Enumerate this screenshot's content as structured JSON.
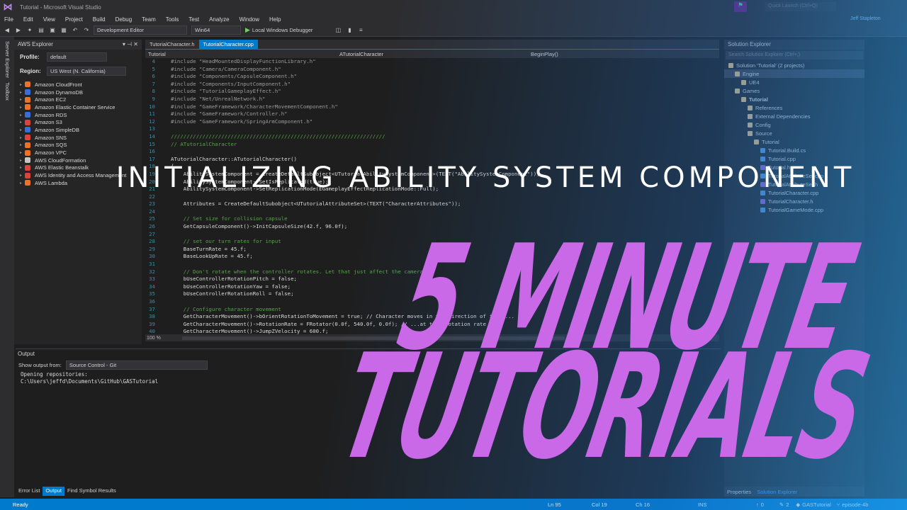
{
  "window": {
    "title": "Tutorial - Microsoft Visual Studio",
    "quick_launch": "Quick Launch (Ctrl+Q)",
    "user": "Jeff Stapleton"
  },
  "menu": [
    "File",
    "Edit",
    "View",
    "Project",
    "Build",
    "Debug",
    "Team",
    "Tools",
    "Test",
    "Analyze",
    "Window",
    "Help"
  ],
  "toolbar": {
    "configuration": "Development Editor",
    "platform": "Win64",
    "debugger": "Local Windows Debugger"
  },
  "side_tabs": [
    "Server Explorer",
    "Toolbox"
  ],
  "aws": {
    "title": "AWS Explorer",
    "profile_label": "Profile:",
    "profile_value": "default",
    "region_label": "Region:",
    "region_value": "US West (N. California)",
    "services": [
      {
        "name": "Amazon CloudFront",
        "color": "#e8732a"
      },
      {
        "name": "Amazon DynamoDB",
        "color": "#3b6fd8"
      },
      {
        "name": "Amazon EC2",
        "color": "#e8732a"
      },
      {
        "name": "Amazon Elastic Container Service",
        "color": "#e8732a"
      },
      {
        "name": "Amazon RDS",
        "color": "#3b6fd8"
      },
      {
        "name": "Amazon S3",
        "color": "#d9453d"
      },
      {
        "name": "Amazon SimpleDB",
        "color": "#3b6fd8"
      },
      {
        "name": "Amazon SNS",
        "color": "#d9453d"
      },
      {
        "name": "Amazon SQS",
        "color": "#e8732a"
      },
      {
        "name": "Amazon VPC",
        "color": "#e8732a"
      },
      {
        "name": "AWS CloudFormation",
        "color": "#c5c5c5"
      },
      {
        "name": "AWS Elastic Beanstalk",
        "color": "#d9453d"
      },
      {
        "name": "AWS Identity and Access Management",
        "color": "#d9453d"
      },
      {
        "name": "AWS Lambda",
        "color": "#e8732a"
      }
    ]
  },
  "editor": {
    "tabs": [
      "TutorialCharacter.h",
      "TutorialCharacter.cpp"
    ],
    "nav": [
      "Tutorial",
      "ATutorialCharacter",
      "BeginPlay()"
    ],
    "zoom": "100 %",
    "lines": [
      {
        "n": "4",
        "t": "#include \"HeadMountedDisplayFunctionLibrary.h\""
      },
      {
        "n": "5",
        "t": "#include \"Camera/CameraComponent.h\""
      },
      {
        "n": "6",
        "t": "#include \"Components/CapsuleComponent.h\""
      },
      {
        "n": "7",
        "t": "#include \"Components/InputComponent.h\""
      },
      {
        "n": "8",
        "t": "#include \"TutorialGameplayEffect.h\""
      },
      {
        "n": "9",
        "t": "#include \"Net/UnrealNetwork.h\""
      },
      {
        "n": "10",
        "t": "#include \"GameFramework/CharacterMovementComponent.h\""
      },
      {
        "n": "11",
        "t": "#include \"GameFramework/Controller.h\""
      },
      {
        "n": "12",
        "t": "#include \"GameFramework/SpringArmComponent.h\""
      },
      {
        "n": "13",
        "t": ""
      },
      {
        "n": "14",
        "t": "////////////////////////////////////////////////////////////////////"
      },
      {
        "n": "15",
        "t": "// ATutorialCharacter"
      },
      {
        "n": "16",
        "t": ""
      },
      {
        "n": "17",
        "t": "ATutorialCharacter::ATutorialCharacter()"
      },
      {
        "n": "18",
        "t": "{"
      },
      {
        "n": "19",
        "t": "    AbilitySystemComponent = CreateDefaultSubobject<UTutorialAbilitySystemComponent>(TEXT(\"AbilitySystemComponent\"));"
      },
      {
        "n": "20",
        "t": "    AbilitySystemComponent->SetIsReplicated(true);"
      },
      {
        "n": "21",
        "t": "    AbilitySystemComponent->SetReplicationMode(EGameplayEffectReplicationMode::Full);"
      },
      {
        "n": "22",
        "t": ""
      },
      {
        "n": "23",
        "t": "    Attributes = CreateDefaultSubobject<UTutorialAttributeSet>(TEXT(\"CharacterAttributes\"));"
      },
      {
        "n": "24",
        "t": ""
      },
      {
        "n": "25",
        "t": "    // Set size for collision capsule"
      },
      {
        "n": "26",
        "t": "    GetCapsuleComponent()->InitCapsuleSize(42.f, 96.0f);"
      },
      {
        "n": "27",
        "t": ""
      },
      {
        "n": "28",
        "t": "    // set our turn rates for input"
      },
      {
        "n": "29",
        "t": "    BaseTurnRate = 45.f;"
      },
      {
        "n": "30",
        "t": "    BaseLookUpRate = 45.f;"
      },
      {
        "n": "31",
        "t": ""
      },
      {
        "n": "32",
        "t": "    // Don't rotate when the controller rotates. Let that just affect the camera."
      },
      {
        "n": "33",
        "t": "    bUseControllerRotationPitch = false;"
      },
      {
        "n": "34",
        "t": "    bUseControllerRotationYaw = false;"
      },
      {
        "n": "35",
        "t": "    bUseControllerRotationRoll = false;"
      },
      {
        "n": "36",
        "t": ""
      },
      {
        "n": "37",
        "t": "    // Configure character movement"
      },
      {
        "n": "38",
        "t": "    GetCharacterMovement()->bOrientRotationToMovement = true; // Character moves in the direction of input..."
      },
      {
        "n": "39",
        "t": "    GetCharacterMovement()->RotationRate = FRotator(0.0f, 540.0f, 0.0f); // ...at this rotation rate"
      },
      {
        "n": "40",
        "t": "    GetCharacterMovement()->JumpZVelocity = 600.f;"
      }
    ]
  },
  "solution": {
    "title": "Solution Explorer",
    "search": "Search Solution Explorer (Ctrl+;)",
    "items": [
      {
        "label": "Solution 'Tutorial' (2 projects)",
        "indent": 0,
        "sel": false
      },
      {
        "label": "Engine",
        "indent": 1,
        "sel": true
      },
      {
        "label": "UE4",
        "indent": 2,
        "sel": false
      },
      {
        "label": "Games",
        "indent": 1,
        "sel": false
      },
      {
        "label": "Tutorial",
        "indent": 2,
        "sel": false
      },
      {
        "label": "References",
        "indent": 3,
        "sel": false
      },
      {
        "label": "External Dependencies",
        "indent": 3,
        "sel": false
      },
      {
        "label": "Config",
        "indent": 3,
        "sel": false
      },
      {
        "label": "Source",
        "indent": 3,
        "sel": false
      },
      {
        "label": "Tutorial",
        "indent": 4,
        "sel": false
      },
      {
        "label": "Tutorial.Build.cs",
        "indent": 5,
        "sel": false
      },
      {
        "label": "Tutorial.cpp",
        "indent": 5,
        "sel": false
      },
      {
        "label": "Tutorial.h",
        "indent": 5,
        "sel": false
      },
      {
        "label": "TutorialAttributeSet.cpp",
        "indent": 5,
        "sel": false
      },
      {
        "label": "TutorialAttributeSet.h",
        "indent": 5,
        "sel": false
      },
      {
        "label": "TutorialCharacter.cpp",
        "indent": 5,
        "sel": false
      },
      {
        "label": "TutorialCharacter.h",
        "indent": 5,
        "sel": false
      },
      {
        "label": "TutorialGameMode.cpp",
        "indent": 5,
        "sel": false
      }
    ],
    "bottom_tabs": [
      "Properties",
      "Solution Explorer"
    ]
  },
  "output": {
    "title": "Output",
    "show_from_label": "Show output from:",
    "show_from_value": "Source Control - Git",
    "text": "Opening repositories:\nC:\\Users\\jeffd\\Documents\\GitHub\\GASTutorial",
    "tabs": [
      "Error List",
      "Output",
      "Find Symbol Results"
    ]
  },
  "status": {
    "ready": "Ready",
    "ln": "Ln 95",
    "col": "Col 19",
    "ch": "Ch 16",
    "ins": "INS",
    "up": "0",
    "pencil": "2",
    "repo": "GASTutorial",
    "branch": "episode-4b"
  },
  "overlay": {
    "subtitle": "INITIALIZING ABILITY SYSTEM COMPONENT",
    "title_line1": "5 MINUTE",
    "title_line2": "TUTORIALS"
  }
}
